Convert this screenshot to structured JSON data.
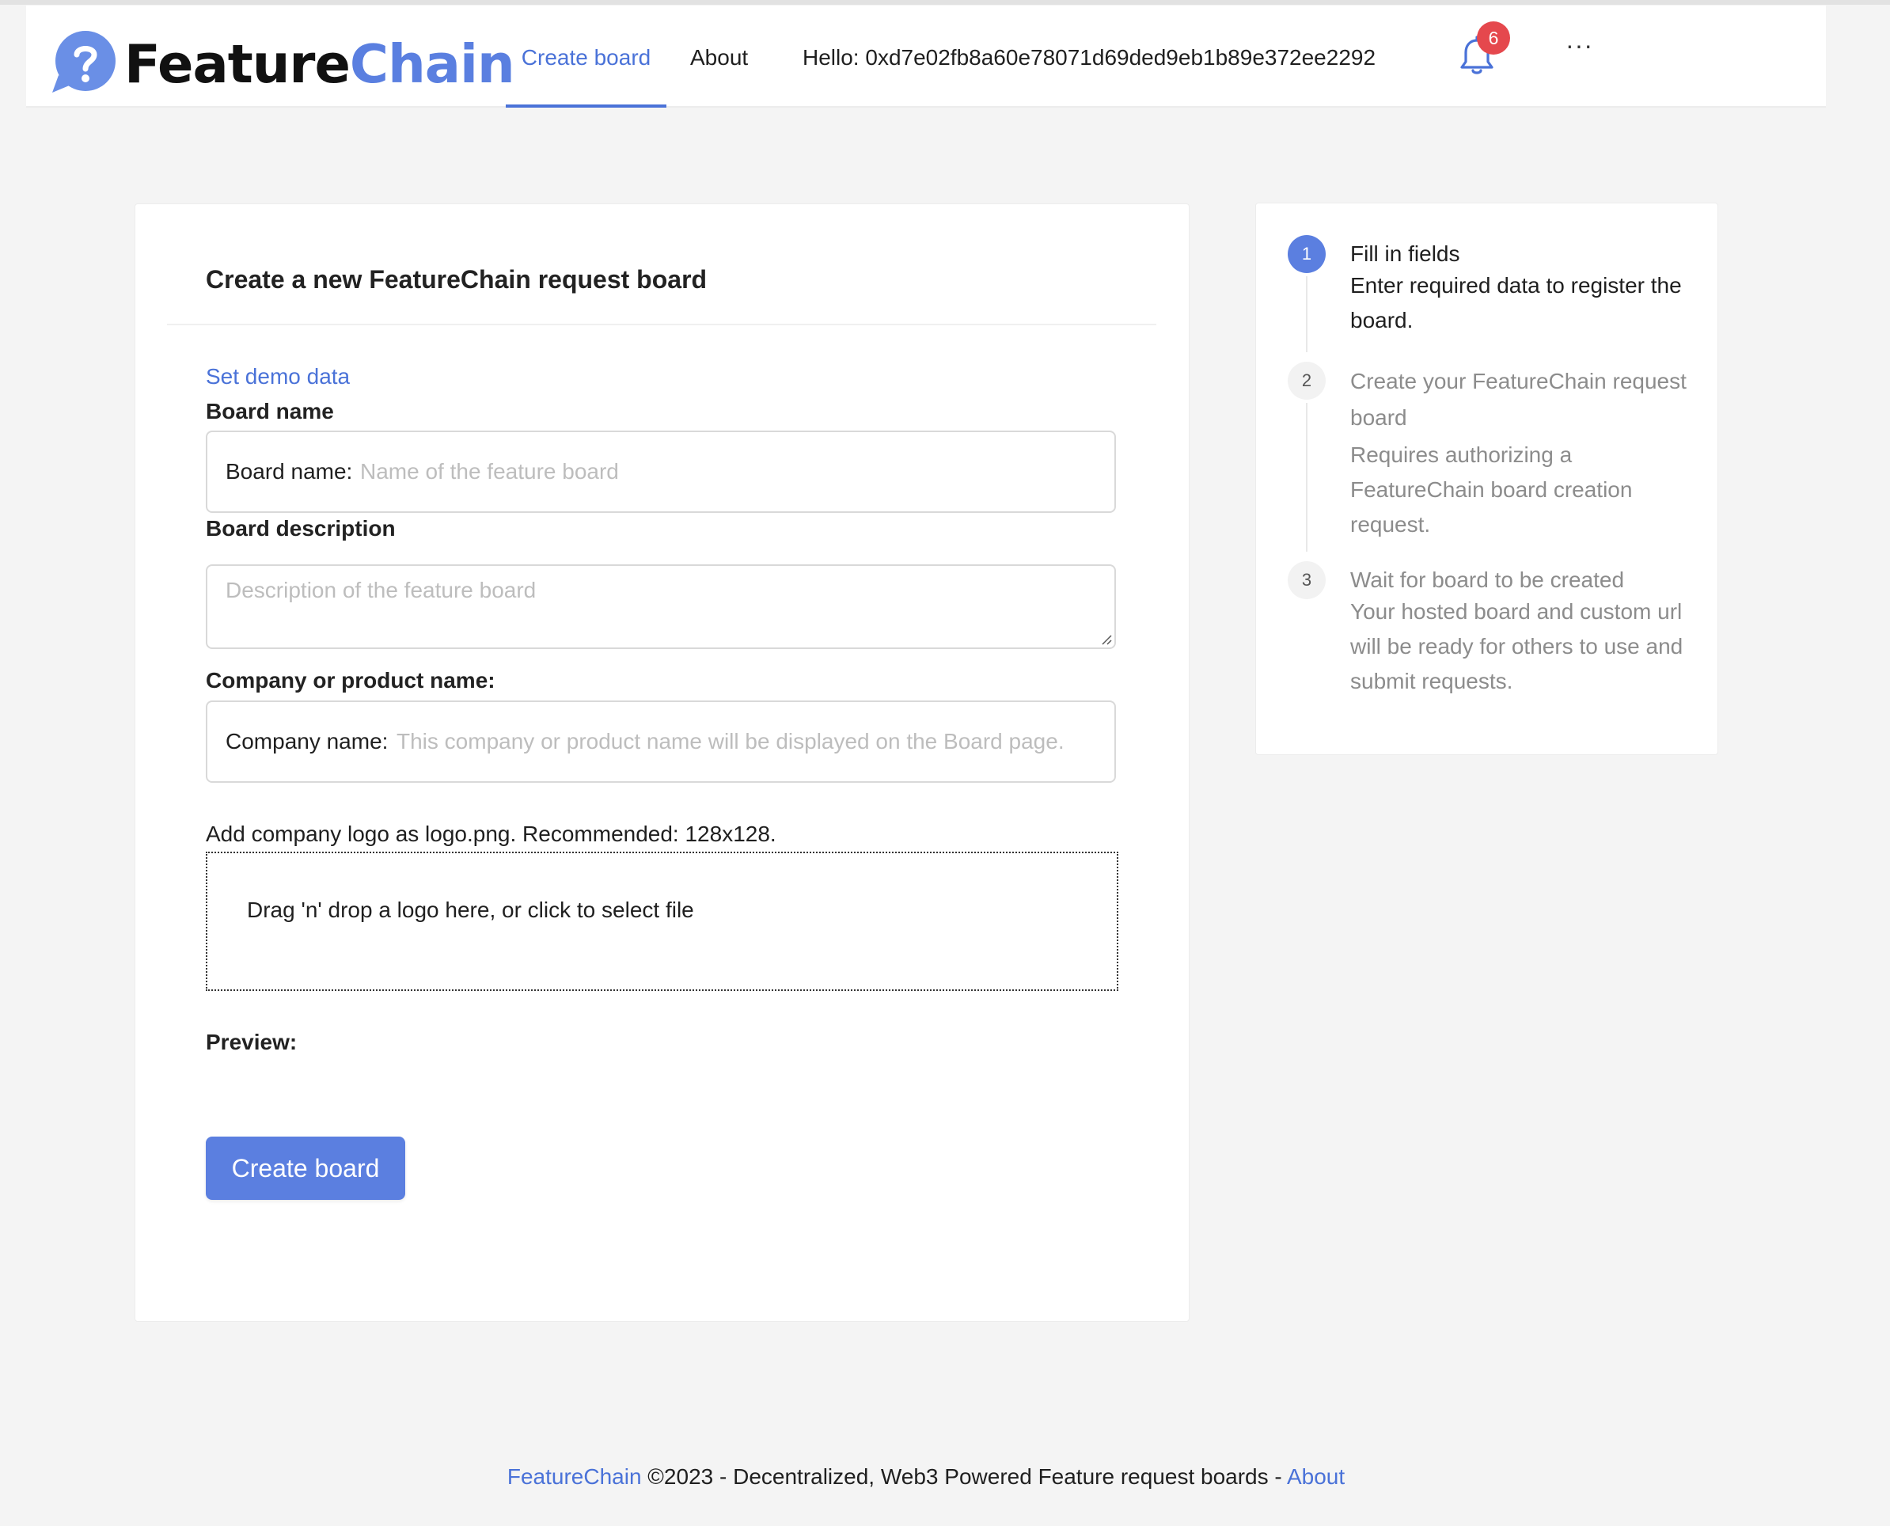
{
  "header": {
    "brand_part1": "Feature",
    "brand_part2": "Chain",
    "nav_create": "Create board",
    "nav_about": "About",
    "greeting": "Hello: 0xd7e02fb8a60e78071d69ded9eb1b89e372ee2292",
    "notification_count": "6",
    "more_label": "···",
    "icons": [
      "question-bubble-icon",
      "bell-icon",
      "more-icon"
    ],
    "accent_color": "#4a72d8"
  },
  "form": {
    "title": "Create a new FeatureChain request board",
    "demo_link": "Set demo data",
    "board_name_label": "Board name",
    "board_name_prefix": "Board name:",
    "board_name_placeholder": "Name of the feature board",
    "board_description_label": "Board description",
    "board_description_placeholder": "Description of the feature board",
    "company_label": "Company or product name:",
    "company_prefix": "Company name:",
    "company_placeholder": "This company or product name will be displayed on the Board page.",
    "logo_label": "Add company logo as logo.png. Recommended: 128x128.",
    "dropzone_text": "Drag 'n' drop a logo here, or click to select file",
    "preview_label": "Preview:",
    "submit_label": "Create board"
  },
  "steps": [
    {
      "number": "1",
      "title": "Fill in fields",
      "description": "Enter required data to register the board.",
      "status": "active"
    },
    {
      "number": "2",
      "title": "Create your FeatureChain request board",
      "description": "Requires authorizing a FeatureChain board creation request.",
      "status": "wait"
    },
    {
      "number": "3",
      "title": "Wait for board to be created",
      "description": "Your hosted board and custom url will be ready for others to use and submit requests.",
      "status": "wait"
    }
  ],
  "footer": {
    "brand_link": "FeatureChain",
    "text": " ©2023 - Decentralized, Web3 Powered Feature request boards - ",
    "about_link": "About"
  }
}
